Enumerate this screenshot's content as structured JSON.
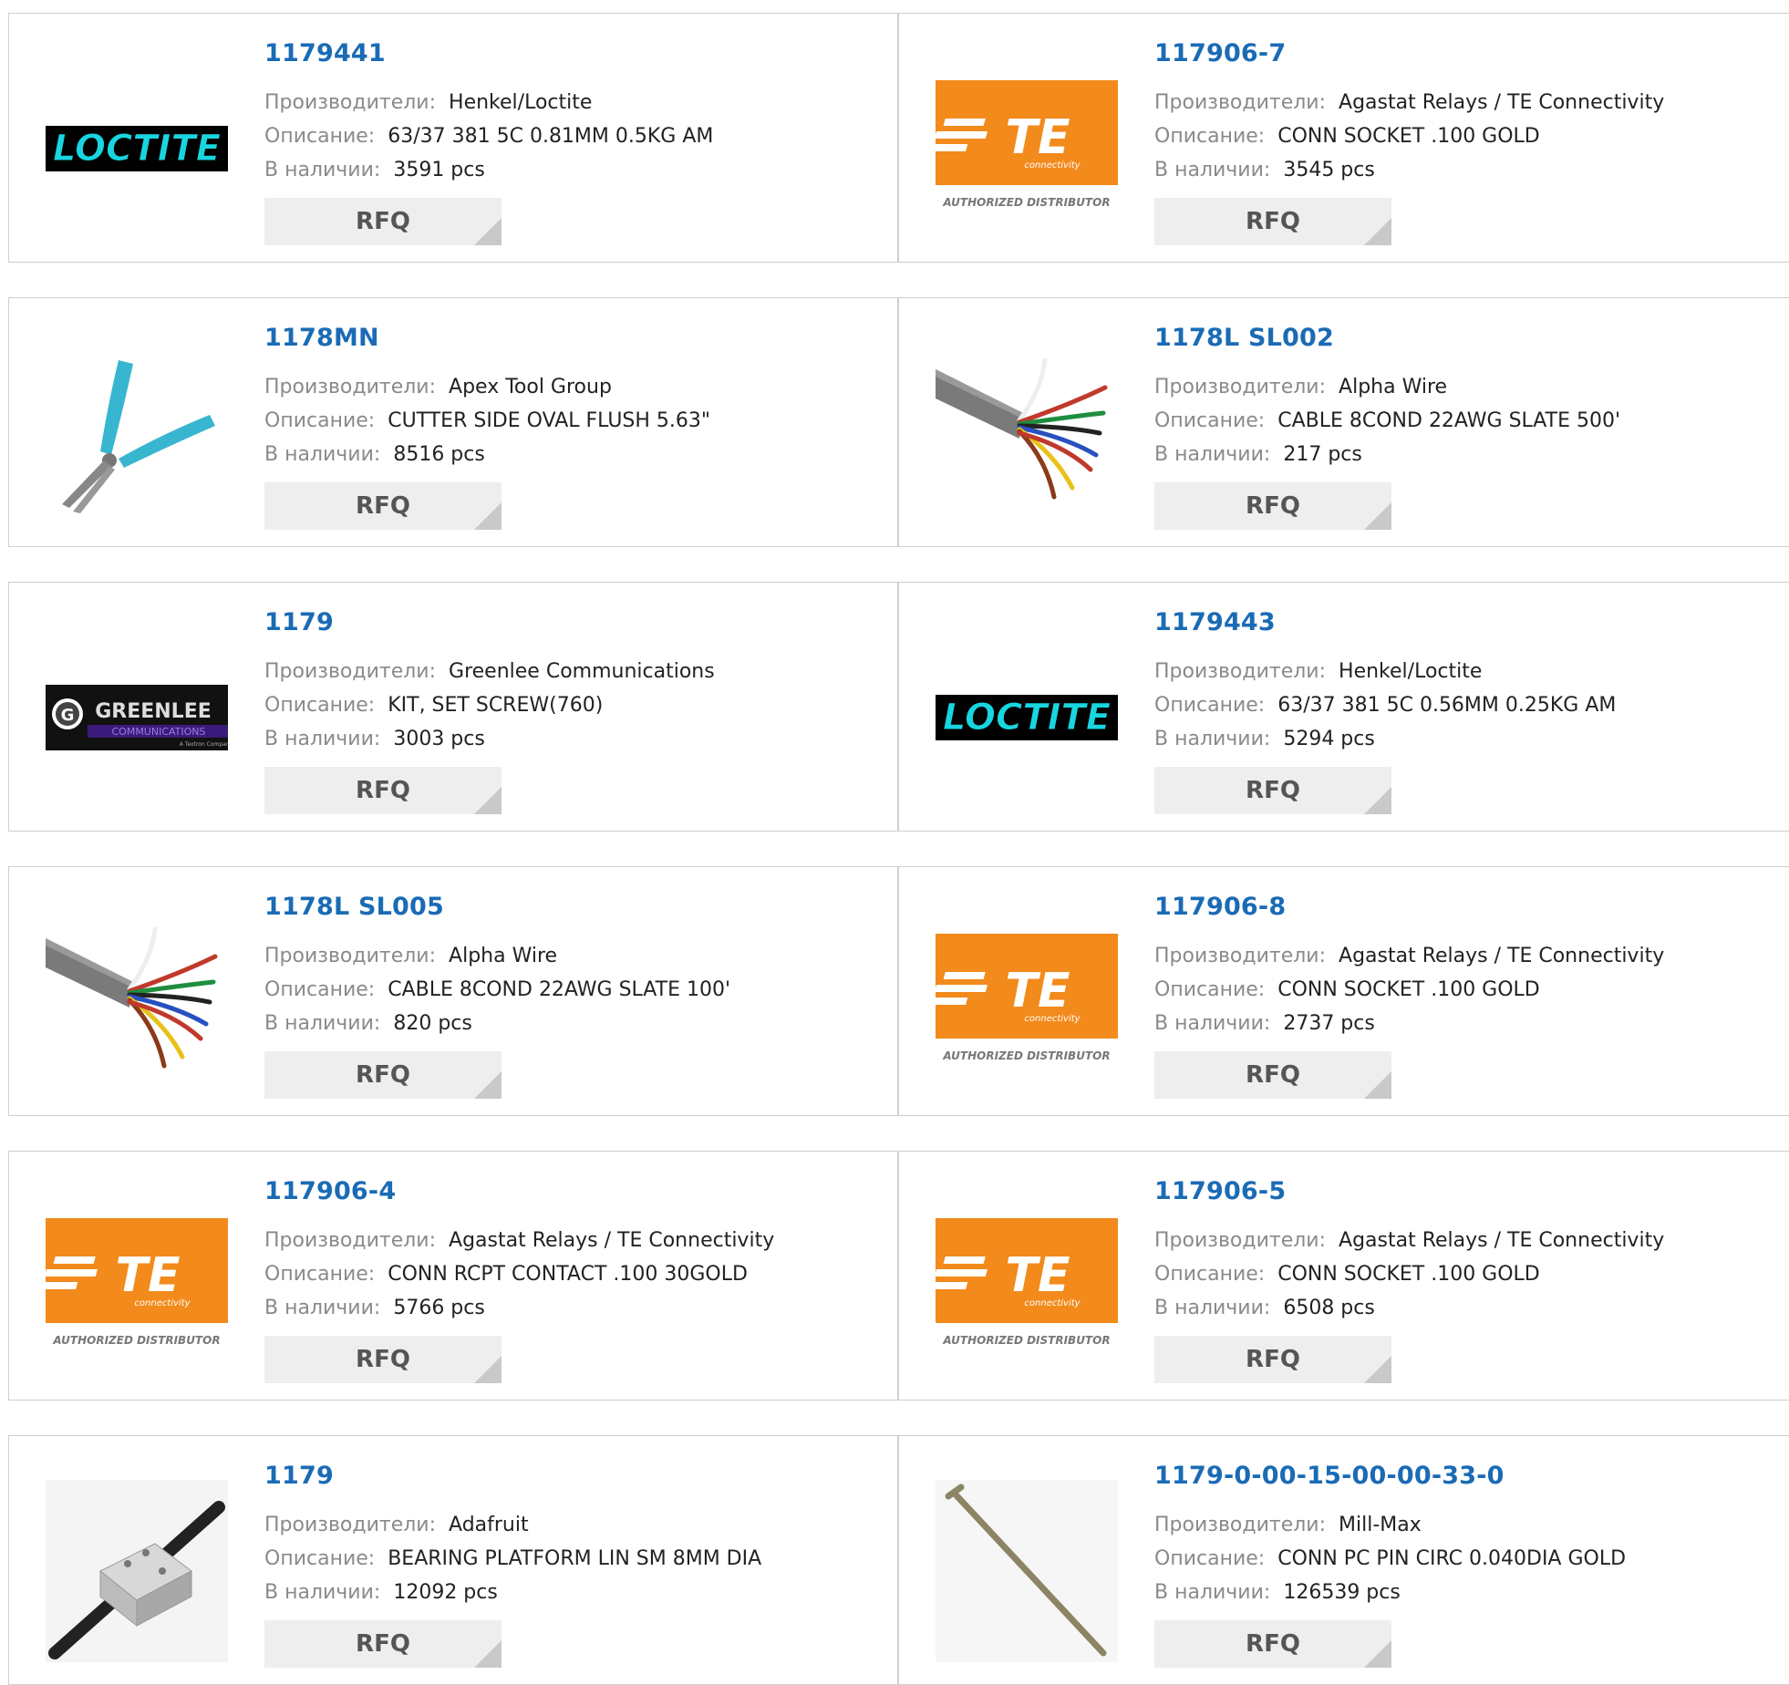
{
  "labels": {
    "manufacturer": "Производители:",
    "description": "Описание:",
    "stock": "В наличии:",
    "rfq": "RFQ"
  },
  "products": [
    {
      "part": "1179441",
      "manufacturer": "Henkel/Loctite",
      "description": "63/37 381 5C 0.81MM 0.5KG AM",
      "stock": "3591 pcs",
      "image": "loctite-logo"
    },
    {
      "part": "117906-7",
      "manufacturer": "Agastat Relays / TE Connectivity",
      "description": "CONN SOCKET .100 GOLD",
      "stock": "3545 pcs",
      "image": "te-connectivity-logo"
    },
    {
      "part": "1178MN",
      "manufacturer": "Apex Tool Group",
      "description": "CUTTER SIDE OVAL FLUSH 5.63\"",
      "stock": "8516 pcs",
      "image": "side-cutter-photo"
    },
    {
      "part": "1178L SL002",
      "manufacturer": "Alpha Wire",
      "description": "CABLE 8COND 22AWG SLATE 500'",
      "stock": "217 pcs",
      "image": "multicore-cable-photo"
    },
    {
      "part": "1179",
      "manufacturer": "Greenlee Communications",
      "description": "KIT, SET SCREW(760)",
      "stock": "3003 pcs",
      "image": "greenlee-logo"
    },
    {
      "part": "1179443",
      "manufacturer": "Henkel/Loctite",
      "description": "63/37 381 5C 0.56MM 0.25KG AM",
      "stock": "5294 pcs",
      "image": "loctite-logo"
    },
    {
      "part": "1178L SL005",
      "manufacturer": "Alpha Wire",
      "description": "CABLE 8COND 22AWG SLATE 100'",
      "stock": "820 pcs",
      "image": "multicore-cable-photo"
    },
    {
      "part": "117906-8",
      "manufacturer": "Agastat Relays / TE Connectivity",
      "description": "CONN SOCKET .100 GOLD",
      "stock": "2737 pcs",
      "image": "te-connectivity-logo"
    },
    {
      "part": "117906-4",
      "manufacturer": "Agastat Relays / TE Connectivity",
      "description": "CONN RCPT CONTACT .100 30GOLD",
      "stock": "5766 pcs",
      "image": "te-connectivity-logo"
    },
    {
      "part": "117906-5",
      "manufacturer": "Agastat Relays / TE Connectivity",
      "description": "CONN SOCKET .100 GOLD",
      "stock": "6508 pcs",
      "image": "te-connectivity-logo"
    },
    {
      "part": "1179",
      "manufacturer": "Adafruit",
      "description": "BEARING PLATFORM LIN SM 8MM DIA",
      "stock": "12092 pcs",
      "image": "linear-bearing-photo"
    },
    {
      "part": "1179-0-00-15-00-00-33-0",
      "manufacturer": "Mill-Max",
      "description": "CONN PC PIN CIRC 0.040DIA GOLD",
      "stock": "126539 pcs",
      "image": "pc-pin-photo"
    }
  ],
  "logo_text": {
    "loctite": "LOCTITE",
    "te": "TE",
    "te_sub": "connectivity",
    "te_badge": "AUTHORIZED DISTRIBUTOR",
    "greenlee": "GREENLEE",
    "greenlee_sub": "COMMUNICATIONS",
    "greenlee_tag": "A Textron Company"
  },
  "colors": {
    "part_link": "#1a6bb5",
    "label": "#8a8a8a",
    "te_orange": "#f28a1c",
    "loctite_cyan": "#18d6e0",
    "rfq_bg": "#eeeeee"
  }
}
